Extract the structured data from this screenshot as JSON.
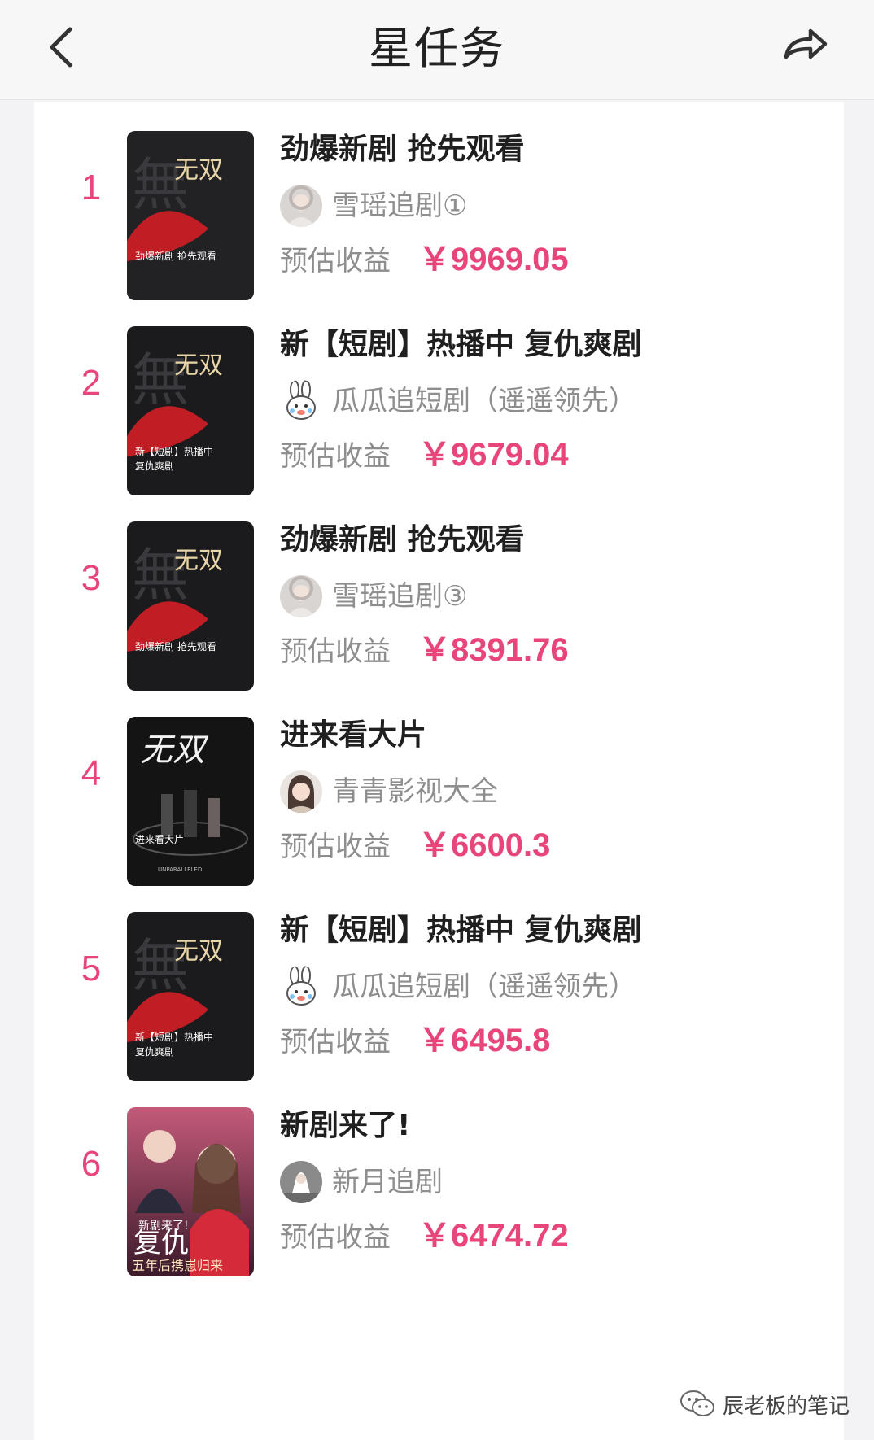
{
  "header": {
    "title": "星任务",
    "back_icon": "back-arrow-icon",
    "share_icon": "share-icon"
  },
  "colors": {
    "accent": "#e8457a",
    "text_primary": "#1f1f1f",
    "text_secondary": "#8e8e8e",
    "background": "#f3f3f5"
  },
  "earnings_label": "预估收益",
  "tasks": [
    {
      "rank": "1",
      "title": "劲爆新剧 抢先观看",
      "author": "雪瑶追剧①",
      "earnings": "￥9969.05",
      "thumb_title": "无双",
      "thumb_caption": "劲爆新剧 抢先观看",
      "thumb_caption2": ""
    },
    {
      "rank": "2",
      "title": "新【短剧】热播中 复仇爽剧",
      "author": "瓜瓜追短剧（遥遥领先）",
      "earnings": "￥9679.04",
      "thumb_title": "无双",
      "thumb_caption": "新【短剧】热播中",
      "thumb_caption2": "复仇爽剧"
    },
    {
      "rank": "3",
      "title": "劲爆新剧 抢先观看",
      "author": "雪瑶追剧③",
      "earnings": "￥8391.76",
      "thumb_title": "无双",
      "thumb_caption": "劲爆新剧 抢先观看",
      "thumb_caption2": ""
    },
    {
      "rank": "4",
      "title": "进来看大片",
      "author": "青青影视大全",
      "earnings": "￥6600.3",
      "thumb_title": "无双",
      "thumb_caption": "进来看大片",
      "thumb_caption2": "UNPARALLELED"
    },
    {
      "rank": "5",
      "title": "新【短剧】热播中 复仇爽剧",
      "author": "瓜瓜追短剧（遥遥领先）",
      "earnings": "￥6495.8",
      "thumb_title": "无双",
      "thumb_caption": "新【短剧】热播中",
      "thumb_caption2": "复仇爽剧"
    },
    {
      "rank": "6",
      "title": "新剧来了!",
      "author": "新月追剧",
      "earnings": "￥6474.72",
      "thumb_title": "复仇",
      "thumb_caption": "新剧来了!",
      "thumb_caption2": "五年后携崽归来"
    }
  ],
  "watermark": {
    "icon": "wechat-icon",
    "text": "辰老板的笔记"
  }
}
